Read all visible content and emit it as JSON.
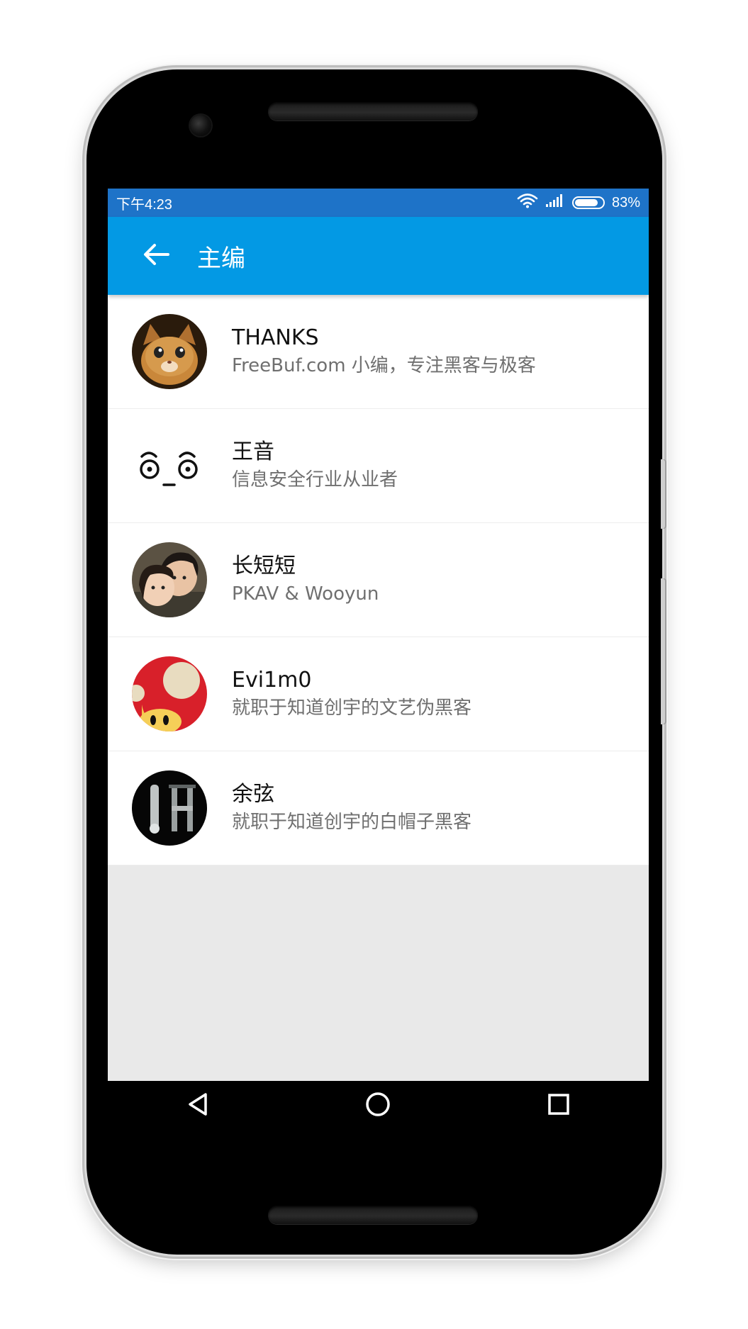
{
  "status_bar": {
    "time": "下午4:23",
    "battery": "83%",
    "battery_level": 0.83
  },
  "app_bar": {
    "title": "主编",
    "back_icon": "arrow-back-icon"
  },
  "editors": [
    {
      "name": "THANKS",
      "description": "FreeBuf.com 小编，专注黑客与极客",
      "avatar": "cat-avatar"
    },
    {
      "name": "王音",
      "description": "信息安全行业从业者",
      "avatar": "face-avatar"
    },
    {
      "name": "长短短",
      "description": "PKAV & Wooyun",
      "avatar": "couple-photo-avatar"
    },
    {
      "name": "Evi1m0",
      "description": "就职于知道创宇的文艺伪黑客",
      "avatar": "mushroom-avatar"
    },
    {
      "name": "余弦",
      "description": "就职于知道创宇的白帽子黑客",
      "avatar": "dark-glyph-avatar"
    }
  ],
  "nav": {
    "back": "triangle-back-icon",
    "home": "circle-home-icon",
    "recents": "square-recents-icon"
  },
  "colors": {
    "status_bar": "#1e73c8",
    "app_bar": "#0399e4",
    "list_bg": "#ffffff",
    "empty_bg": "#e9e9e9"
  }
}
